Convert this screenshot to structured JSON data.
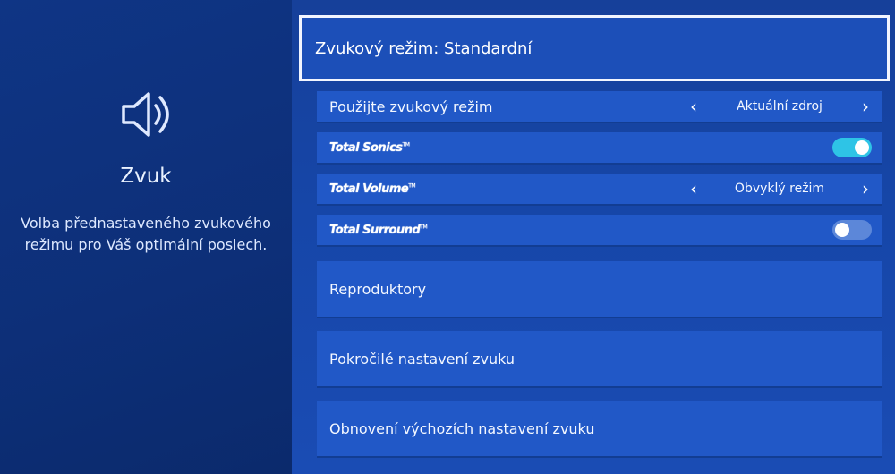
{
  "panel": {
    "icon": "speaker-icon",
    "title": "Zvuk",
    "description_lines": [
      "Volba přednastaveného zvukového",
      "režimu pro Váš optimální poslech."
    ]
  },
  "header": {
    "label": "Zvukový režim: Standardní"
  },
  "items": [
    {
      "label": "Použijte zvukový režim",
      "value": "Aktuální zdroj",
      "type": "selector"
    },
    {
      "label": "Total Sonics",
      "type": "toggle",
      "state": "on"
    },
    {
      "label": "Total Volume",
      "value": "Obvyklý režim",
      "type": "selector"
    },
    {
      "label": "Total Surround",
      "type": "toggle",
      "state": "off"
    },
    {
      "label": "Reproduktory",
      "type": "link"
    },
    {
      "label": "Pokročilé nastavení zvuku",
      "type": "link"
    },
    {
      "label": "Obnovení výchozích nastavení zvuku",
      "type": "link"
    }
  ],
  "colors": {
    "toggle_on": "#2ec4e6",
    "toggle_off": "#5c87d9",
    "row_bg": "#2158c7"
  }
}
